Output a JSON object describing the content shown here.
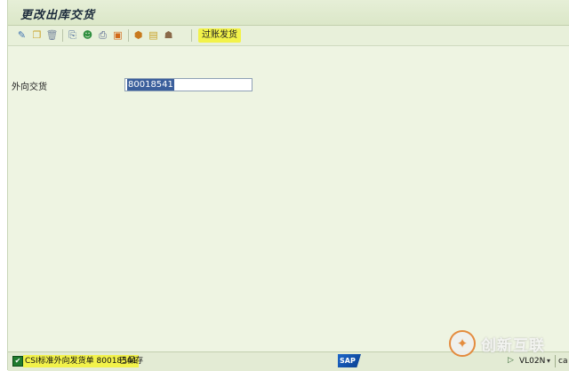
{
  "window": {
    "title": "更改出库交货"
  },
  "toolbar": {
    "icons": [
      {
        "name": "change-display-icon",
        "glyph": "✎",
        "color": "#3a6fb0"
      },
      {
        "name": "create-icon",
        "glyph": "❐",
        "color": "#c9a227"
      },
      {
        "name": "delete-icon",
        "glyph": "🗑",
        "color": "#7a8aa0"
      },
      {
        "name": "copy-icon",
        "glyph": "⎘",
        "color": "#4a6a9a"
      },
      {
        "name": "partner-icon",
        "glyph": "☻",
        "color": "#2f8f3f"
      },
      {
        "name": "print-icon",
        "glyph": "⎙",
        "color": "#4a5a8a"
      },
      {
        "name": "document-flow-icon",
        "glyph": "▣",
        "color": "#d26a1a"
      },
      {
        "name": "package-icon",
        "glyph": "⬢",
        "color": "#c87a1e"
      },
      {
        "name": "picking-icon",
        "glyph": "▤",
        "color": "#c9a227"
      },
      {
        "name": "route-icon",
        "glyph": "☗",
        "color": "#8a6a4a"
      }
    ],
    "post_goods_issue": "过账发货"
  },
  "form": {
    "outbound_delivery_label": "外向交货",
    "outbound_delivery_value": "80018541"
  },
  "status": {
    "message_highlight": "CSI标准外向发货单 80018541",
    "message_suffix": "已保存",
    "sap_logo": "SAP",
    "transaction": "VL02N",
    "transaction_arrow": "▾",
    "host": "ca"
  },
  "watermark": {
    "mark": "✦",
    "text": "创新互联"
  }
}
